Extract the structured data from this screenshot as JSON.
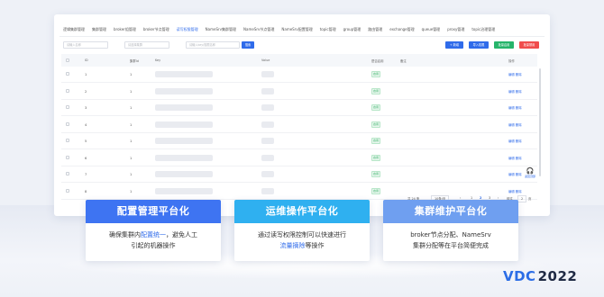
{
  "tabs": [
    "逻辑集群管理",
    "集群管理",
    "broker组管理",
    "broker节点管理",
    "读写权限管理",
    "NameSrv集群管理",
    "NameSrv节点管理",
    "NameSrv配置管理",
    "topic管理",
    "group管理",
    "路由管理",
    "exchange管理",
    "queue管理",
    "proxy管理",
    "topic治理管理"
  ],
  "active_tab_index": 4,
  "toolbar": {
    "search1_placeholder": "请输入名称",
    "search2_placeholder": "请选择集群",
    "search3_placeholder": "请输入key/权限名称",
    "search_button": "搜索",
    "add_button": "+ 新增",
    "import_button": "导入权限",
    "enable_button": "批量启用",
    "disable_button": "批量禁用"
  },
  "colors": {
    "primary": "#2f6bea",
    "green": "#26b46a",
    "red": "#f04c4c",
    "card1_head": "#3e74f2",
    "card2_head": "#2fb0f0",
    "card3_head": "#6f9ff0"
  },
  "table": {
    "headers": [
      "ID",
      "集群Id",
      "Key",
      "Value",
      "是否启用",
      "备注",
      "操作"
    ],
    "rows": [
      {
        "id": "1",
        "cluster": "1",
        "status": "启用",
        "ops": "编辑 删除"
      },
      {
        "id": "2",
        "cluster": "1",
        "status": "启用",
        "ops": "编辑 删除"
      },
      {
        "id": "3",
        "cluster": "1",
        "status": "启用",
        "ops": "编辑 删除"
      },
      {
        "id": "4",
        "cluster": "1",
        "status": "启用",
        "ops": "编辑 删除"
      },
      {
        "id": "5",
        "cluster": "1",
        "status": "启用",
        "ops": "编辑 删除"
      },
      {
        "id": "6",
        "cluster": "1",
        "status": "启用",
        "ops": "编辑 删除"
      },
      {
        "id": "7",
        "cluster": "1",
        "status": "启用",
        "ops": "编辑 删除"
      },
      {
        "id": "8",
        "cluster": "1",
        "status": "启用",
        "ops": "编辑 删除"
      }
    ]
  },
  "float_button_label": "返回顶部",
  "pager": {
    "total": "共 24 条",
    "page_size": "10条/页",
    "pages": [
      "1",
      "2",
      "3"
    ],
    "current": "2",
    "jump_label": "前往",
    "jump_value": "2",
    "page_unit": "页"
  },
  "cards": [
    {
      "title": "配置管理平台化",
      "line1_a": "确保集群内",
      "line1_hl": "配置统一",
      "line1_b": "，避免人工",
      "line2": "引起的机器操作"
    },
    {
      "title": "运维操作平台化",
      "line1_a": "通过读写权限控制可以快速进行",
      "line1_hl": "",
      "line1_b": "",
      "line2_hl": "流量摘除",
      "line2_b": "等操作"
    },
    {
      "title": "集群维护平台化",
      "line1_a": "broker节点分配、NameSrv",
      "line1_hl": "",
      "line1_b": "",
      "line2": "集群分配等在平台简便完成"
    }
  ],
  "logo": {
    "mark": "VDC",
    "year": "2022"
  }
}
